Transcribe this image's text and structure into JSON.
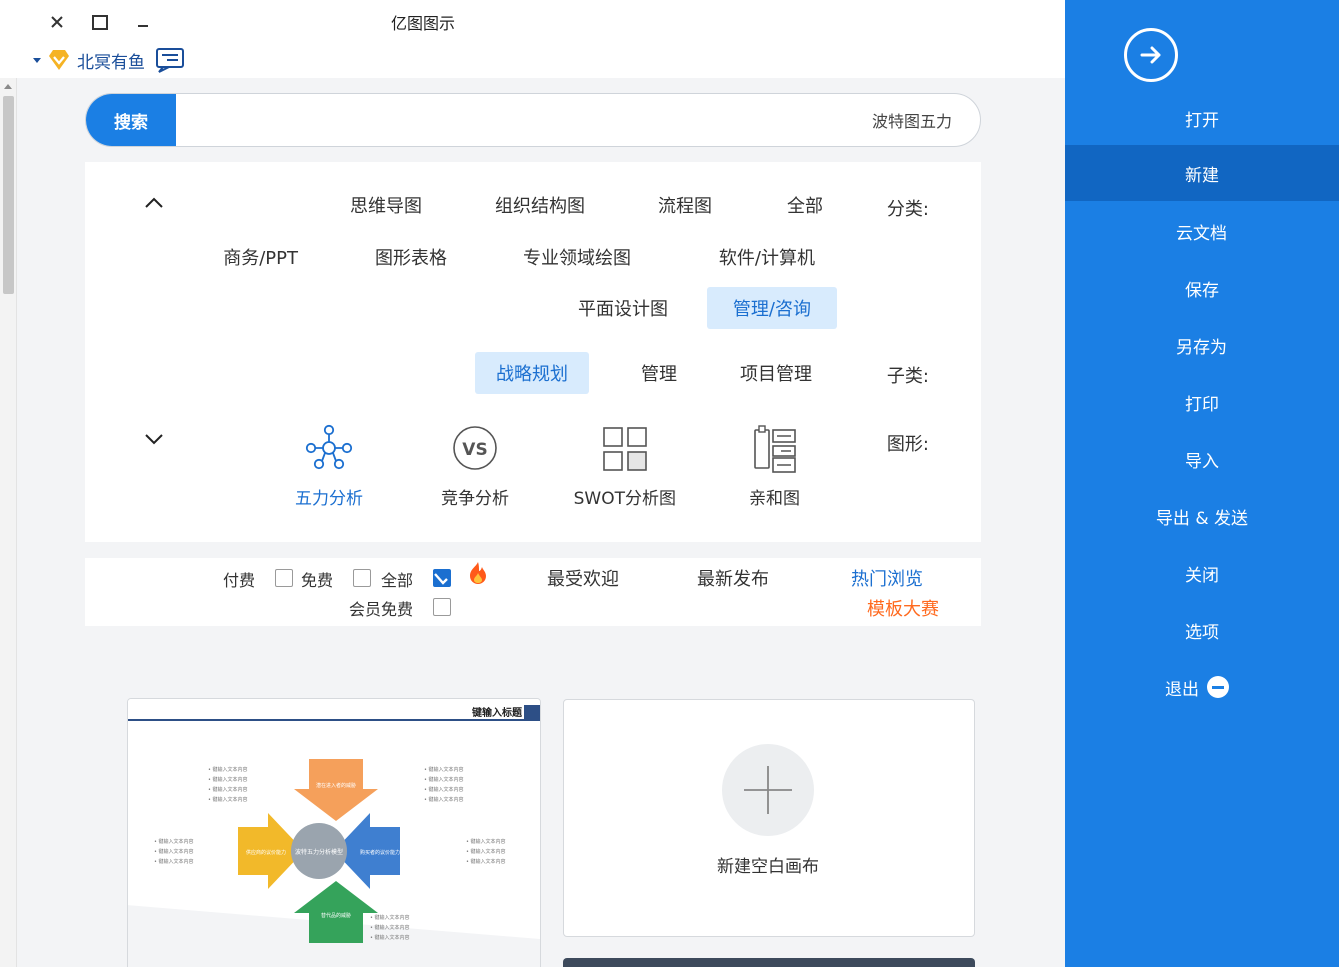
{
  "window": {
    "title": "亿图图示"
  },
  "account": {
    "name": "北冥有鱼"
  },
  "sidebar": {
    "items": [
      {
        "label": "打开"
      },
      {
        "label": "新建"
      },
      {
        "label": "云文档"
      },
      {
        "label": "保存"
      },
      {
        "label": "另存为"
      },
      {
        "label": "打印"
      },
      {
        "label": "导入"
      },
      {
        "label": "导出 & 发送"
      },
      {
        "label": "关闭"
      },
      {
        "label": "选项"
      },
      {
        "label": "退出"
      }
    ],
    "active_index": 1
  },
  "search": {
    "value": "波特图五力",
    "button": "搜索"
  },
  "filters": {
    "category_label": "分类:",
    "categories": [
      "全部",
      "流程图",
      "组织结构图",
      "思维导图",
      "软件/计算机",
      "专业领域绘图",
      "图形表格",
      "商务/PPT",
      "管理/咨询",
      "平面设计图"
    ],
    "active_category": "管理/咨询",
    "subcategory_label": "子类:",
    "subcategories": [
      "项目管理",
      "管理",
      "战略规划"
    ],
    "active_subcategory": "战略规划",
    "shape_label": "图形:",
    "shapes": [
      {
        "label": "亲和图",
        "icon": "affinity-icon"
      },
      {
        "label": "SWOT分析图",
        "icon": "swot-grid-icon"
      },
      {
        "label": "竞争分析",
        "icon": "vs-icon"
      },
      {
        "label": "五力分析",
        "icon": "five-forces-icon"
      }
    ],
    "active_shape": "五力分析",
    "vs_text": "VS"
  },
  "sort": {
    "tabs": [
      "热门浏览",
      "最新发布",
      "最受欢迎"
    ],
    "active_tab": "热门浏览",
    "contest": "模板大赛",
    "price_options": [
      {
        "label": "全部",
        "checked": true
      },
      {
        "label": "免费",
        "checked": false
      },
      {
        "label": "付费",
        "checked": false
      },
      {
        "label": "会员免费",
        "checked": false
      }
    ]
  },
  "new_canvas": {
    "label": "新建空白画布"
  },
  "template_preview": {
    "title": "键输入标题",
    "center": "波特五力分析模型",
    "arrows": [
      "潜在进入者的威胁",
      "供应商的议价能力",
      "购买者的议价能力",
      "替代品的威胁"
    ],
    "bullet": "• 键输入文本内容"
  },
  "colors": {
    "brand": "#1b7fe4",
    "active_chip_bg": "#d8ebfd",
    "accent_orange": "#ff6a1f"
  }
}
